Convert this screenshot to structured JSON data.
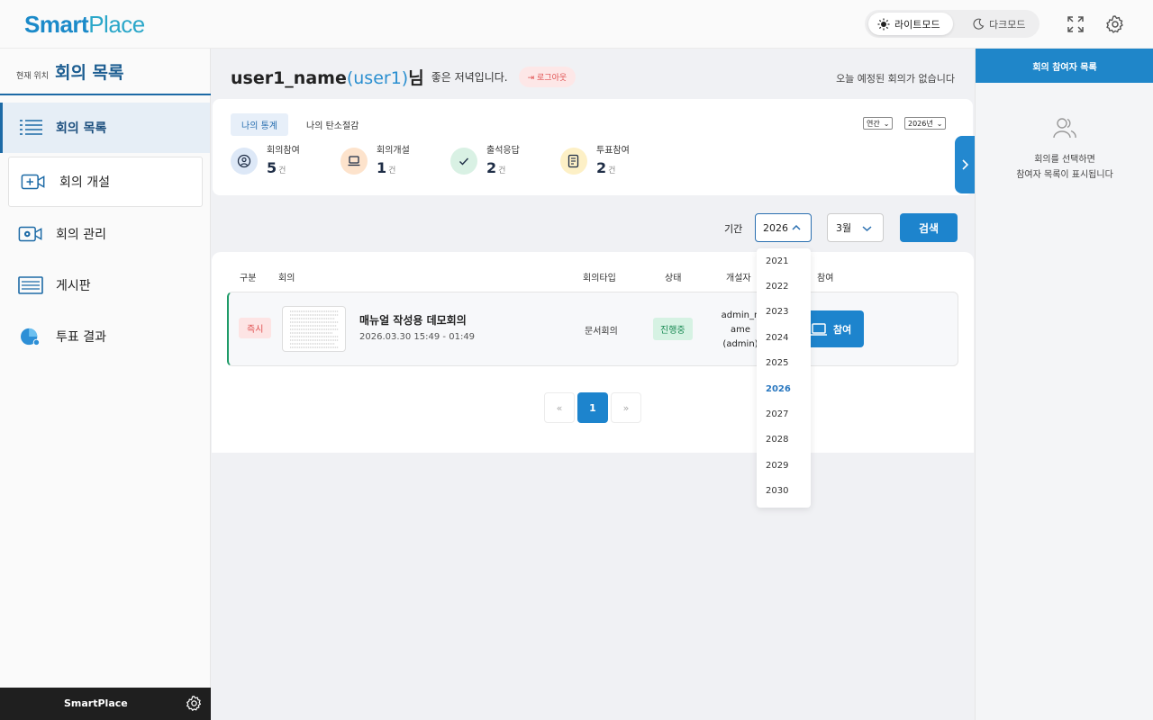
{
  "app": {
    "logo_part1": "Smart",
    "logo_part2": "Place"
  },
  "topbar": {
    "light_mode": "라이트모드",
    "dark_mode": "다크모드"
  },
  "sidebar": {
    "location_label": "현재 위치",
    "location_title": "회의 목록",
    "items": [
      {
        "label": "회의 목록",
        "icon": "list-icon"
      },
      {
        "label": "회의 개설",
        "icon": "video-add-icon"
      },
      {
        "label": "회의 관리",
        "icon": "video-settings-icon"
      },
      {
        "label": "게시판",
        "icon": "board-icon"
      },
      {
        "label": "투표 결과",
        "icon": "pie-chart-icon"
      }
    ],
    "footer": "SmartPlace"
  },
  "header": {
    "user_name": "user1_name",
    "user_id": "(user1)",
    "suffix": "님",
    "greeting": "좋은 저녁입니다.",
    "logout": "로그아웃",
    "notice": "오늘 예정된 회의가 없습니다"
  },
  "stats": {
    "tab_active": "나의 통계",
    "tab_other": "나의 탄소절감",
    "period_select": "연간",
    "year_select": "2026년",
    "items": [
      {
        "label": "회의참여",
        "value": "5",
        "unit": "건"
      },
      {
        "label": "회의개설",
        "value": "1",
        "unit": "건"
      },
      {
        "label": "출석응답",
        "value": "2",
        "unit": "건"
      },
      {
        "label": "투표참여",
        "value": "2",
        "unit": "건"
      }
    ]
  },
  "filter": {
    "period_label": "기간",
    "year": "2026",
    "month": "3월",
    "search": "검색",
    "year_options": [
      "2021",
      "2022",
      "2023",
      "2024",
      "2025",
      "2026",
      "2027",
      "2028",
      "2029",
      "2030"
    ]
  },
  "table": {
    "headers": {
      "category": "구분",
      "meeting": "회의",
      "type": "회의타입",
      "status": "상태",
      "owner": "개설자",
      "join": "참여"
    },
    "rows": [
      {
        "category": "즉시",
        "title": "매뉴얼 작성용 데모회의",
        "datetime": "2026.03.30 15:49 - 01:49",
        "type": "문서회의",
        "status": "진행중",
        "owner_line1": "admin_n",
        "owner_line2": "ame",
        "owner_line3": "(admin)",
        "join": "참여"
      }
    ]
  },
  "pagination": {
    "prev": "«",
    "current": "1",
    "next": "»"
  },
  "right_panel": {
    "title": "회의 참여자 목록",
    "message_line1": "회의를 선택하면",
    "message_line2": "참여자 목록이 표시됩니다"
  },
  "colors": {
    "primary": "#1d84cd",
    "accent_green": "#1f9b68",
    "danger": "#e05050"
  }
}
